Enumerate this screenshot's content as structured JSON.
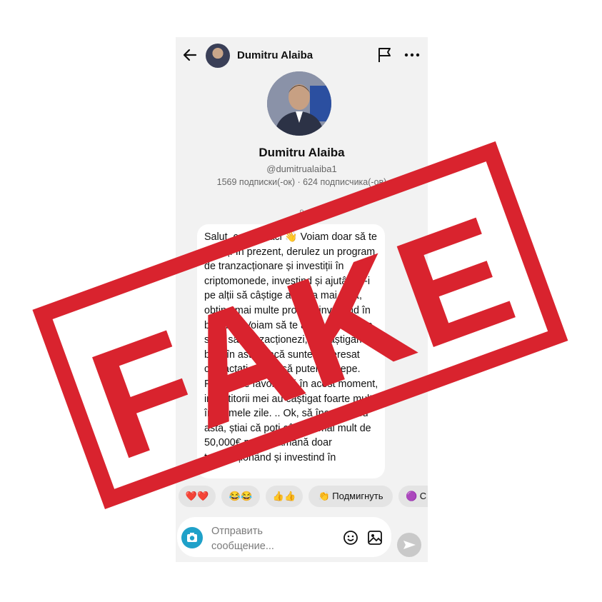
{
  "header": {
    "name": "Dumitru Alaiba",
    "icons": [
      "back-arrow-icon",
      "avatar",
      "flag-icon",
      "more-icon"
    ]
  },
  "profile": {
    "name": "Dumitru Alaiba",
    "handle": "@dumitrualaiba1",
    "stats": "1569 подписки(-ок) · 624 подписчика(-ов)",
    "timestamp": "9"
  },
  "message": {
    "text": "Salut, ce mai faci 👋 Voiam doar să te anunț. În prezent, derulez un program de tranzacționare și investiții în criptomonede, investind și ajutându-i pe alții să câștige analiza mai mult, obține mai multe profituri investind în bitcoins. Voiam să te ajut, unii doresc să și să tranzacționezi, să câștigăm bani în asta, dacă sunteți interesat contactați-mă ca să putem începe. Piața este favorabilă în acest moment, investitorii mei au câștigat foarte mult în ultimele zile. .. Ok, să începem cu asta, știai că poți câștiga mai mult de 50,000€ pe săptămână doar tranzacționând și investind în"
  },
  "reactions": [
    {
      "label": "❤️❤️"
    },
    {
      "label": "😂😂"
    },
    {
      "label": "👍👍"
    },
    {
      "label": "👏 Подмигнуть"
    },
    {
      "label": "🟣 С"
    }
  ],
  "composer": {
    "placeholder": "Отправить сообщение..."
  },
  "stamp": {
    "text": "FAKE",
    "color": "#d9232e"
  },
  "colors": {
    "phone_bg": "#f2f2f2",
    "camera": "#1fa1c9",
    "send": "#c9c9c9"
  }
}
